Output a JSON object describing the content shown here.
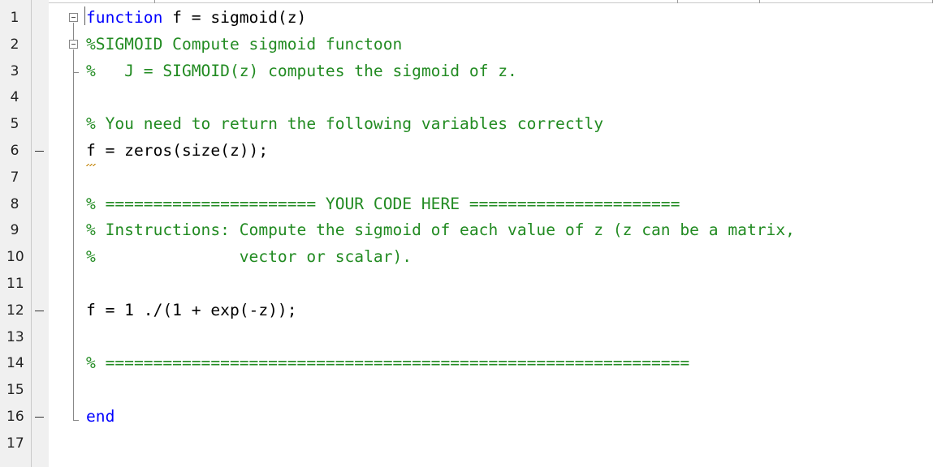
{
  "editor": {
    "lines": [
      {
        "num": "1",
        "marker": false
      },
      {
        "num": "2",
        "marker": false
      },
      {
        "num": "3",
        "marker": false
      },
      {
        "num": "4",
        "marker": false
      },
      {
        "num": "5",
        "marker": false
      },
      {
        "num": "6",
        "marker": true
      },
      {
        "num": "7",
        "marker": false
      },
      {
        "num": "8",
        "marker": false
      },
      {
        "num": "9",
        "marker": false
      },
      {
        "num": "10",
        "marker": false
      },
      {
        "num": "11",
        "marker": false
      },
      {
        "num": "12",
        "marker": true
      },
      {
        "num": "13",
        "marker": false
      },
      {
        "num": "14",
        "marker": false
      },
      {
        "num": "15",
        "marker": false
      },
      {
        "num": "16",
        "marker": true
      },
      {
        "num": "17",
        "marker": false
      }
    ],
    "code": {
      "l1_kw": "function",
      "l1_rest": " f = sigmoid(z)",
      "l2": "%SIGMOID Compute sigmoid functoon",
      "l3": "%   J = SIGMOID(z) computes the sigmoid of z.",
      "l4": "",
      "l5": "% You need to return the following variables correctly",
      "l6": "f = zeros(size(z));",
      "l7": "",
      "l8": "% ====================== YOUR CODE HERE ======================",
      "l9": "% Instructions: Compute the sigmoid of each value of z (z can be a matrix,",
      "l10": "%               vector or scalar).",
      "l11": "",
      "l12": "f = 1 ./(1 + exp(-z));",
      "l13": "",
      "l14": "% =============================================================",
      "l15": "",
      "l16_kw": "end",
      "l17": ""
    }
  },
  "colors": {
    "keyword": "#0000ff",
    "comment": "#228b22",
    "text": "#000000",
    "gutter": "#f0f0f0"
  }
}
